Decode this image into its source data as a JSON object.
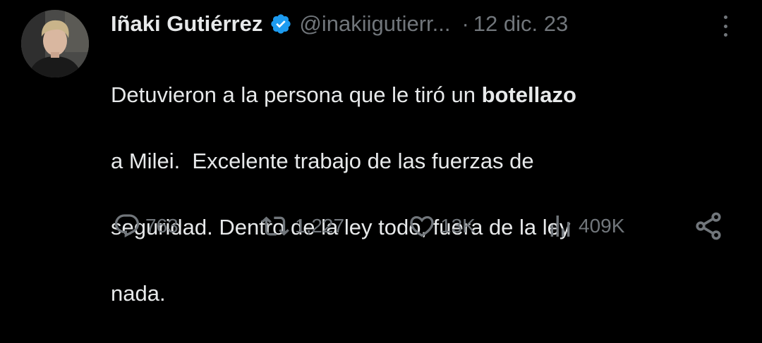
{
  "author": {
    "display_name": "Iñaki Gutiérrez",
    "handle": "@inakiigutierr...",
    "date_separator": "·",
    "date": "12 dic. 23",
    "avatar_icon": "avatar-photo",
    "verified_icon": "verified-badge-icon",
    "verified_color": "#1d9bf0"
  },
  "tweet": {
    "line1_start": "Detuvieron a la persona que le tiró un ",
    "line1_bold": "botellazo",
    "line2": "a Milei.  Excelente trabajo de las fuerzas de",
    "line3": "seguridad. Dentro de la ley todo, fuera de la ley",
    "line4": "nada."
  },
  "actions": {
    "replies": "763",
    "retweets": "1,227",
    "likes": "13K",
    "views": "409K",
    "reply_icon": "reply-icon",
    "retweet_icon": "retweet-icon",
    "like_icon": "heart-icon",
    "views_icon": "views-icon",
    "share_icon": "share-icon"
  },
  "colors": {
    "background": "#000000",
    "text": "#e7e9ea",
    "secondary": "#71767b",
    "accent": "#1d9bf0"
  }
}
